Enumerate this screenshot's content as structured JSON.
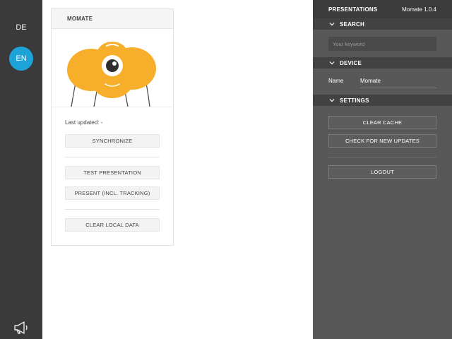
{
  "languages": [
    {
      "label": "DE",
      "active": false
    },
    {
      "label": "EN",
      "active": true
    }
  ],
  "rail": {
    "bottom_icon": "megaphone-icon"
  },
  "card": {
    "title": "MOMATE",
    "last_updated": "Last updated: -",
    "buttons": {
      "synchronize": "SYNCHRONIZE",
      "test_presentation": "TEST PRESENTATION",
      "present_tracking": "PRESENT (INCL. TRACKING)",
      "clear_local_data": "CLEAR LOCAL DATA"
    },
    "mascot_color": "#f7ae2b"
  },
  "panel": {
    "title": "PRESENTATIONS",
    "version": "Momate 1.0.4",
    "sections": {
      "search": "SEARCH",
      "device": "DEVICE",
      "settings": "SETTINGS"
    },
    "search": {
      "placeholder": "Your keyword",
      "value": ""
    },
    "device": {
      "name_label": "Name",
      "name_value": "Momate"
    },
    "buttons": {
      "clear_cache": "CLEAR CACHE",
      "check_updates": "CHECK FOR NEW UPDATES",
      "logout": "LOGOUT"
    }
  },
  "colors": {
    "accent": "#1ea3d8",
    "rail_bg": "#3a3a3a",
    "panel_bg": "#585858"
  }
}
